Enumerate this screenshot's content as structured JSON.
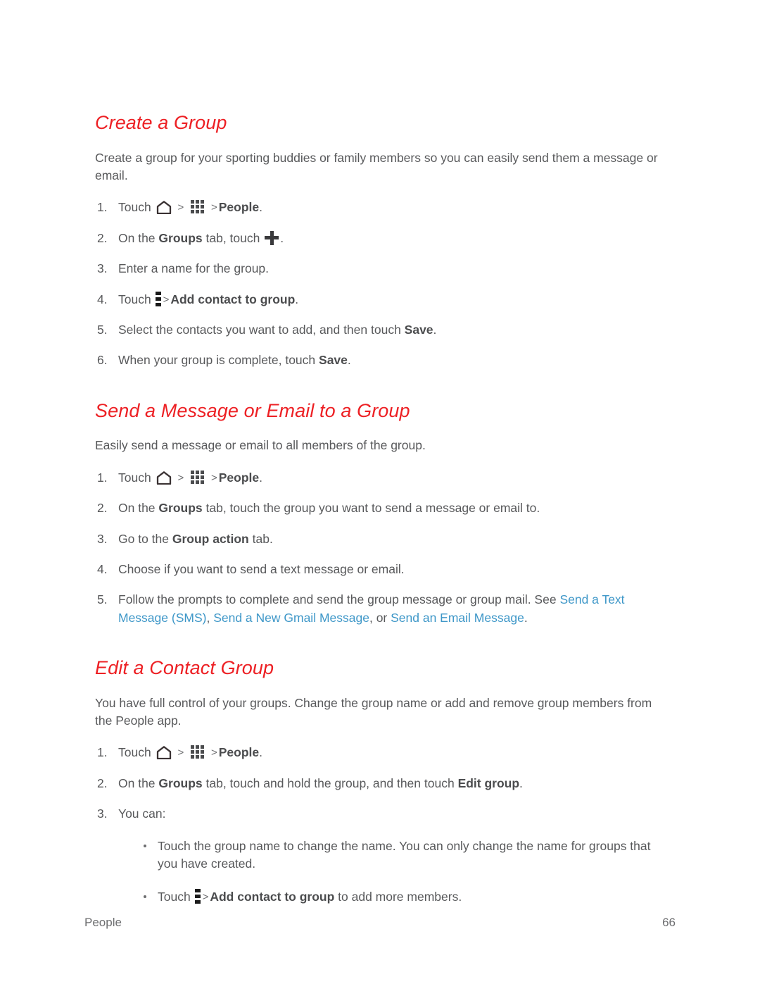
{
  "document": {
    "footer": {
      "section_label": "People",
      "page_number": "66"
    },
    "colors": {
      "heading_red": "#ed2024",
      "body_gray": "#58595b",
      "link_blue": "#3e97c8"
    }
  },
  "sections": [
    {
      "heading": "Create a Group",
      "intro": "Create a group for your sporting buddies or family members so you can easily send them a message or email.",
      "steps": [
        {
          "pre": "Touch",
          "icons": [
            "home-icon",
            "apps-grid-icon"
          ],
          "bold": "People",
          "post": "."
        },
        {
          "pre": "On the ",
          "bold": "Groups",
          "mid": " tab, touch ",
          "icons": [
            "plus-icon"
          ],
          "post": "."
        },
        {
          "text": "Enter a name for the group."
        },
        {
          "pre": "Touch",
          "icons": [
            "overflow-menu-icon"
          ],
          "bold": "Add contact to group",
          "post": "."
        },
        {
          "pre": "Select the contacts you want to add, and then touch ",
          "bold": "Save",
          "post": "."
        },
        {
          "pre": "When your group is complete, touch ",
          "bold": "Save",
          "post": "."
        }
      ]
    },
    {
      "heading": "Send a Message or Email to a Group",
      "intro": "Easily send a message or email to all members of the group.",
      "steps": [
        {
          "pre": "Touch",
          "icons": [
            "home-icon",
            "apps-grid-icon"
          ],
          "bold": "People",
          "post": "."
        },
        {
          "pre": "On the ",
          "bold": "Groups",
          "post": " tab, touch the group you want to send a message or email to."
        },
        {
          "pre": "Go to the ",
          "bold": "Group action",
          "post": " tab."
        },
        {
          "text": "Choose if you want to send a text message or email."
        },
        {
          "pre": "Follow the prompts to complete and send the group message or group mail. See ",
          "links": [
            "Send a Text Message (SMS)",
            "Send a New Gmail Message",
            "Send an Email Message"
          ],
          "link_sep_1": ", ",
          "link_sep_2": ", or ",
          "post": "."
        }
      ]
    },
    {
      "heading": "Edit a Contact Group",
      "intro": "You have full control of your groups. Change the group name or add and remove group members from the People app.",
      "steps": [
        {
          "pre": "Touch",
          "icons": [
            "home-icon",
            "apps-grid-icon"
          ],
          "bold": "People",
          "post": "."
        },
        {
          "pre": "On the ",
          "bold": "Groups",
          "mid": " tab, touch and hold the group, and then touch ",
          "bold2": "Edit group",
          "post": "."
        },
        {
          "text": "You can:"
        }
      ],
      "bullets": [
        {
          "text": "Touch the group name to change the name. You can only change the name for groups that you have created."
        },
        {
          "pre": "Touch",
          "icons": [
            "overflow-menu-icon"
          ],
          "bold": "Add contact to group",
          "post": " to add more members."
        }
      ]
    }
  ]
}
